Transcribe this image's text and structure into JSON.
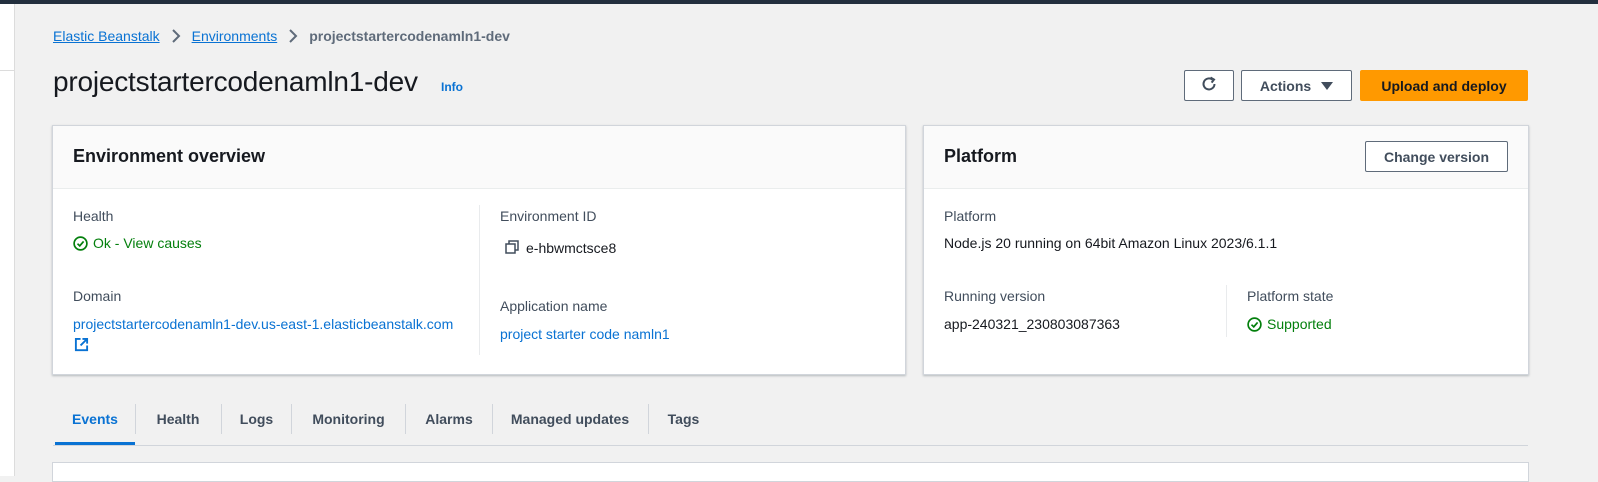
{
  "breadcrumb": {
    "items": [
      "Elastic Beanstalk",
      "Environments"
    ],
    "current": "projectstartercodenamln1-dev"
  },
  "page": {
    "title": "projectstartercodenamln1-dev",
    "info": "Info"
  },
  "header_actions": {
    "refresh_icon": "refresh-icon",
    "actions_label": "Actions",
    "upload_label": "Upload and deploy"
  },
  "overview": {
    "title": "Environment overview",
    "health_label": "Health",
    "health_value": "Ok - View causes",
    "domain_label": "Domain",
    "domain_value": "projectstartercodenamln1-dev.us-east-1.elasticbeanstalk.com",
    "env_id_label": "Environment ID",
    "env_id_value": "e-hbwmctsce8",
    "app_name_label": "Application name",
    "app_name_value": "project starter code namln1"
  },
  "platform": {
    "title": "Platform",
    "change_version": "Change version",
    "platform_label": "Platform",
    "platform_value": "Node.js 20 running on 64bit Amazon Linux 2023/6.1.1",
    "running_label": "Running version",
    "running_value": "app-240321_230803087363",
    "state_label": "Platform state",
    "state_value": "Supported"
  },
  "tabs": [
    "Events",
    "Health",
    "Logs",
    "Monitoring",
    "Alarms",
    "Managed updates",
    "Tags"
  ],
  "colors": {
    "accent": "#0972d3",
    "primary_button": "#ff9900",
    "success": "#037f0c",
    "topbar": "#232f3e"
  }
}
